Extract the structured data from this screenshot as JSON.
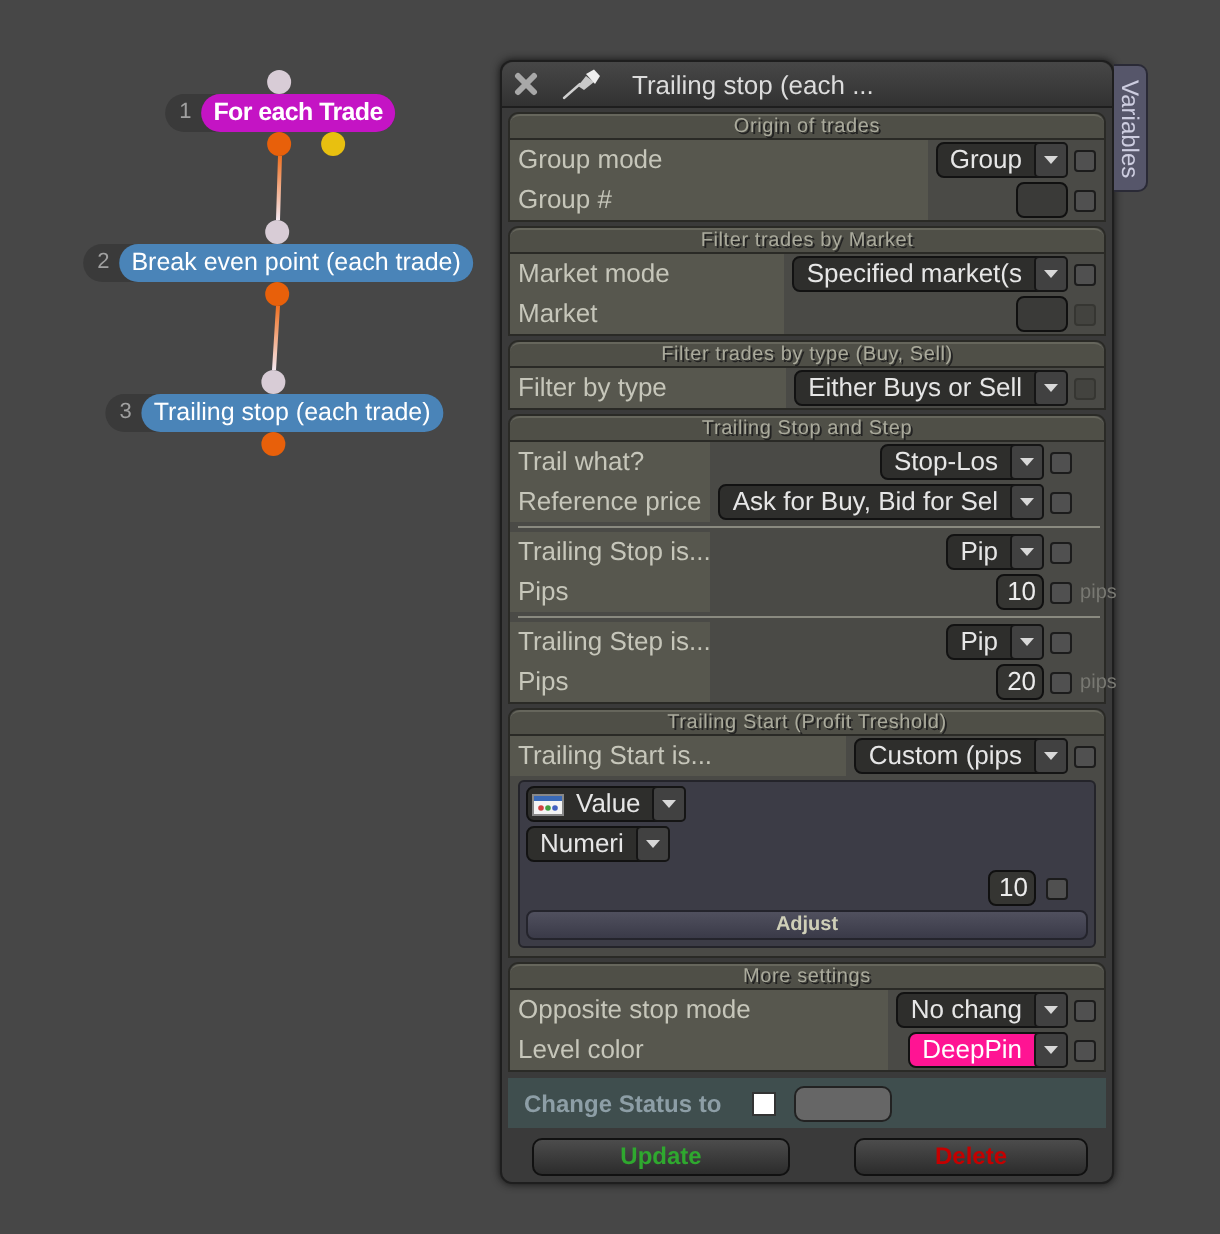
{
  "canvas": {
    "nodes": [
      {
        "number": "1",
        "label": "For each Trade",
        "kind": "loop",
        "color": "#c414c4",
        "outputs": [
          {
            "color": "#e8600a"
          },
          {
            "color": "#e8c010"
          }
        ]
      },
      {
        "number": "2",
        "label": "Break even point (each trade)",
        "kind": "action",
        "color": "#4a84b8",
        "outputs": [
          {
            "color": "#e8600a"
          }
        ]
      },
      {
        "number": "3",
        "label": "Trailing stop (each trade)",
        "kind": "action",
        "color": "#4a84b8",
        "outputs": [
          {
            "color": "#e8600a"
          }
        ]
      }
    ]
  },
  "panel": {
    "title": "Trailing stop (each ...",
    "side_tab": "Variables",
    "sections": [
      {
        "title": "Origin of trades",
        "groups": [
          {
            "rows": [
              {
                "kind": "select",
                "label": "Group mode",
                "value": "Group",
                "checkbox": {
                  "checked": false,
                  "disabled": false
                }
              },
              {
                "kind": "field",
                "label": "Group #",
                "checkbox": {
                  "checked": false,
                  "disabled": false
                }
              }
            ]
          }
        ]
      },
      {
        "title": "Filter trades by Market",
        "groups": [
          {
            "rows": [
              {
                "kind": "select",
                "label": "Market mode",
                "value": "Specified market(s",
                "checkbox": {
                  "checked": false,
                  "disabled": false
                }
              },
              {
                "kind": "field",
                "label": "Market",
                "checkbox": {
                  "checked": false,
                  "disabled": true
                }
              }
            ]
          }
        ]
      },
      {
        "title": "Filter trades by type (Buy, Sell)",
        "groups": [
          {
            "rows": [
              {
                "kind": "select",
                "label": "Filter by type",
                "value": "Either Buys or Sell",
                "checkbox": {
                  "checked": false,
                  "disabled": true
                }
              }
            ]
          }
        ]
      },
      {
        "title": "Trailing Stop and Step",
        "groups": [
          {
            "rows": [
              {
                "kind": "select",
                "label": "Trail what?",
                "value": "Stop-Los",
                "checkbox": {
                  "checked": false,
                  "disabled": false
                }
              },
              {
                "kind": "select",
                "label": "Reference price",
                "value": "Ask for Buy, Bid for Sel",
                "checkbox": {
                  "checked": false,
                  "disabled": false
                }
              }
            ]
          },
          {
            "rows": [
              {
                "kind": "select",
                "label": "Trailing Stop is...",
                "value": "Pip",
                "checkbox": {
                  "checked": false,
                  "disabled": false
                }
              },
              {
                "kind": "field",
                "label": "Pips",
                "value": "10",
                "unit": "pips",
                "checkbox": {
                  "checked": false,
                  "disabled": false
                }
              }
            ]
          },
          {
            "rows": [
              {
                "kind": "select",
                "label": "Trailing Step is...",
                "value": "Pip",
                "checkbox": {
                  "checked": false,
                  "disabled": false
                }
              },
              {
                "kind": "field",
                "label": "Pips",
                "value": "20",
                "unit": "pips",
                "checkbox": {
                  "checked": false,
                  "disabled": false
                }
              }
            ]
          }
        ]
      },
      {
        "title": "Trailing Start (Profit Treshold)",
        "groups": [
          {
            "rows": [
              {
                "kind": "select",
                "label": "Trailing Start is...",
                "value": "Custom (pips",
                "checkbox": {
                  "checked": false,
                  "disabled": false
                }
              }
            ]
          }
        ],
        "subpanel": {
          "source": {
            "value": "Value"
          },
          "type": {
            "value": "Numeri"
          },
          "number": {
            "value": "10",
            "checkbox": {
              "checked": false,
              "disabled": false
            }
          },
          "button": "Adjust"
        }
      },
      {
        "title": "More settings",
        "groups": [
          {
            "rows": [
              {
                "kind": "select",
                "label": "Opposite stop mode",
                "value": "No chang",
                "checkbox": {
                  "checked": false,
                  "disabled": false
                }
              },
              {
                "kind": "select",
                "label": "Level color",
                "value": "DeepPin",
                "color": "#ff1493",
                "checkbox": {
                  "checked": false,
                  "disabled": false
                }
              }
            ]
          }
        ]
      }
    ],
    "status_change": {
      "label": "Change Status to",
      "checked": false
    },
    "buttons": [
      {
        "label": "Update",
        "kind": "confirm"
      },
      {
        "label": "Delete",
        "kind": "danger"
      }
    ]
  }
}
